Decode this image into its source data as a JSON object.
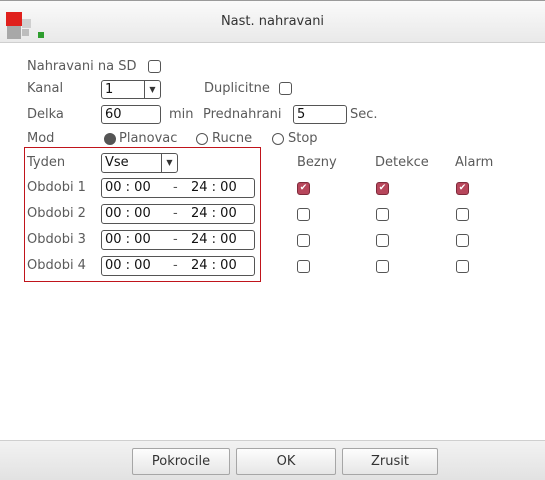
{
  "window": {
    "title": "Nast. nahravani"
  },
  "form": {
    "sd_label": "Nahravani na SD",
    "sd_checked": false,
    "channel_label": "Kanal",
    "channel_value": "1",
    "duplicate_label": "Duplicitne",
    "duplicate_checked": false,
    "length_label": "Delka",
    "length_value": "60",
    "length_unit": "min",
    "prerecord_label": "Prednahrani",
    "prerecord_value": "5",
    "prerecord_unit": "Sec.",
    "mode_label": "Mod",
    "mode_options": [
      "Planovac",
      "Rucne",
      "Stop"
    ],
    "mode_selected": "Planovac"
  },
  "schedule": {
    "week_label": "Tyden",
    "week_value": "Vse",
    "columns": [
      "Bezny",
      "Detekce",
      "Alarm"
    ],
    "periods": [
      {
        "label": "Obdobi 1",
        "start": "00 : 00",
        "sep": "-",
        "end": "24 : 00",
        "bezny": true,
        "detekce": true,
        "alarm": true
      },
      {
        "label": "Obdobi 2",
        "start": "00 : 00",
        "sep": "-",
        "end": "24 : 00",
        "bezny": false,
        "detekce": false,
        "alarm": false
      },
      {
        "label": "Obdobi 3",
        "start": "00 : 00",
        "sep": "-",
        "end": "24 : 00",
        "bezny": false,
        "detekce": false,
        "alarm": false
      },
      {
        "label": "Obdobi 4",
        "start": "00 : 00",
        "sep": "-",
        "end": "24 : 00",
        "bezny": false,
        "detekce": false,
        "alarm": false
      }
    ]
  },
  "buttons": {
    "advanced": "Pokrocile",
    "ok": "OK",
    "cancel": "Zrusit"
  },
  "colors": {
    "accent_red": "#c0141b",
    "checked_fill": "#b7465b",
    "logo_red": "#e0201c",
    "logo_green": "#2f9e2f"
  }
}
